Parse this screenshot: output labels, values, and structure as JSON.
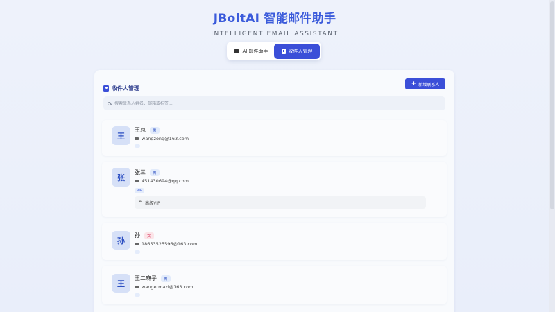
{
  "header": {
    "title": "JBoltAI 智能邮件助手",
    "subtitle": "INTELLIGENT EMAIL ASSISTANT"
  },
  "mode_switch": {
    "ai_label": "AI 邮件助手",
    "contacts_label": "收件人管理"
  },
  "panel": {
    "title": "收件人管理",
    "add_button": "新增联系人",
    "search_placeholder": "搜索联系人姓名、邮箱或标签..."
  },
  "contacts": [
    {
      "avatar": "王",
      "name": "王总",
      "gender": "男",
      "email": "wangzong@163.com",
      "tag": "",
      "note": ""
    },
    {
      "avatar": "张",
      "name": "张三",
      "gender": "男",
      "email": "451430694@qq.com",
      "tag": "VIP",
      "note": "高级VIP"
    },
    {
      "avatar": "孙",
      "name": "孙",
      "gender": "女",
      "email": "18653525596@163.com",
      "tag": "",
      "note": ""
    },
    {
      "avatar": "王",
      "name": "王二麻子",
      "gender": "男",
      "email": "wangermazi@163.com",
      "tag": "",
      "note": ""
    }
  ],
  "colors": {
    "accent": "#3b4fd8",
    "title": "#3b5bdb",
    "male_badge_bg": "#e2ebfb",
    "female_badge_bg": "#fbe4e8"
  }
}
